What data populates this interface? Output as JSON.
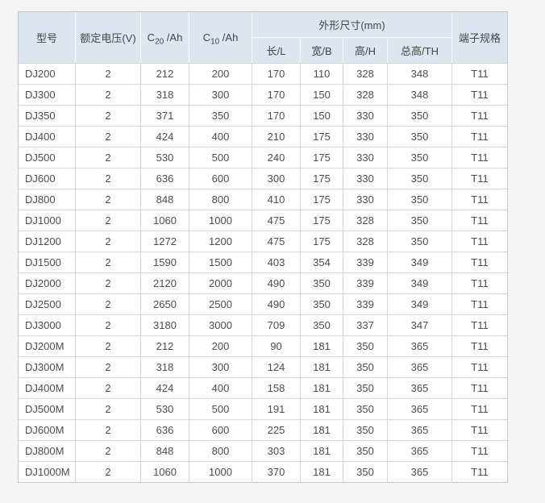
{
  "table": {
    "header": {
      "model": "型号",
      "voltage": "额定电压(V)",
      "c20": {
        "base": "C",
        "sub": "20",
        "unit": " /Ah"
      },
      "c10": {
        "base": "C",
        "sub": "10",
        "unit": " /Ah"
      },
      "dimensions_group": "外形尺寸(mm)",
      "length": "长/L",
      "width": "宽/B",
      "height": "高/H",
      "total_height": "总高/TH",
      "terminal": "端子规格"
    },
    "rows": [
      [
        "DJ200",
        "2",
        "212",
        "200",
        "170",
        "110",
        "328",
        "348",
        "T11"
      ],
      [
        "DJ300",
        "2",
        "318",
        "300",
        "170",
        "150",
        "328",
        "348",
        "T11"
      ],
      [
        "DJ350",
        "2",
        "371",
        "350",
        "170",
        "150",
        "330",
        "350",
        "T11"
      ],
      [
        "DJ400",
        "2",
        "424",
        "400",
        "210",
        "175",
        "330",
        "350",
        "T11"
      ],
      [
        "DJ500",
        "2",
        "530",
        "500",
        "240",
        "175",
        "330",
        "350",
        "T11"
      ],
      [
        "DJ600",
        "2",
        "636",
        "600",
        "300",
        "175",
        "330",
        "350",
        "T11"
      ],
      [
        "DJ800",
        "2",
        "848",
        "800",
        "410",
        "175",
        "330",
        "350",
        "T11"
      ],
      [
        "DJ1000",
        "2",
        "1060",
        "1000",
        "475",
        "175",
        "328",
        "350",
        "T11"
      ],
      [
        "DJ1200",
        "2",
        "1272",
        "1200",
        "475",
        "175",
        "328",
        "350",
        "T11"
      ],
      [
        "DJ1500",
        "2",
        "1590",
        "1500",
        "403",
        "354",
        "339",
        "349",
        "T11"
      ],
      [
        "DJ2000",
        "2",
        "2120",
        "2000",
        "490",
        "350",
        "339",
        "349",
        "T11"
      ],
      [
        "DJ2500",
        "2",
        "2650",
        "2500",
        "490",
        "350",
        "339",
        "349",
        "T11"
      ],
      [
        "DJ3000",
        "2",
        "3180",
        "3000",
        "709",
        "350",
        "337",
        "347",
        "T11"
      ],
      [
        "DJ200M",
        "2",
        "212",
        "200",
        "90",
        "181",
        "350",
        "365",
        "T11"
      ],
      [
        "DJ300M",
        "2",
        "318",
        "300",
        "124",
        "181",
        "350",
        "365",
        "T11"
      ],
      [
        "DJ400M",
        "2",
        "424",
        "400",
        "158",
        "181",
        "350",
        "365",
        "T11"
      ],
      [
        "DJ500M",
        "2",
        "530",
        "500",
        "191",
        "181",
        "350",
        "365",
        "T11"
      ],
      [
        "DJ600M",
        "2",
        "636",
        "600",
        "225",
        "181",
        "350",
        "365",
        "T11"
      ],
      [
        "DJ800M",
        "2",
        "848",
        "800",
        "303",
        "181",
        "350",
        "365",
        "T11"
      ],
      [
        "DJ1000M",
        "2",
        "1060",
        "1000",
        "370",
        "181",
        "350",
        "365",
        "T11"
      ]
    ]
  },
  "colors": {
    "header_bg": "#dce6f0",
    "header_divider": "#f4f8fb",
    "cell_bg": "#ffffff",
    "border": "#d6d6d6",
    "outer_border": "#c9c9c9",
    "text": "#4d4d4d",
    "page_bg": "#f5f5f6"
  }
}
